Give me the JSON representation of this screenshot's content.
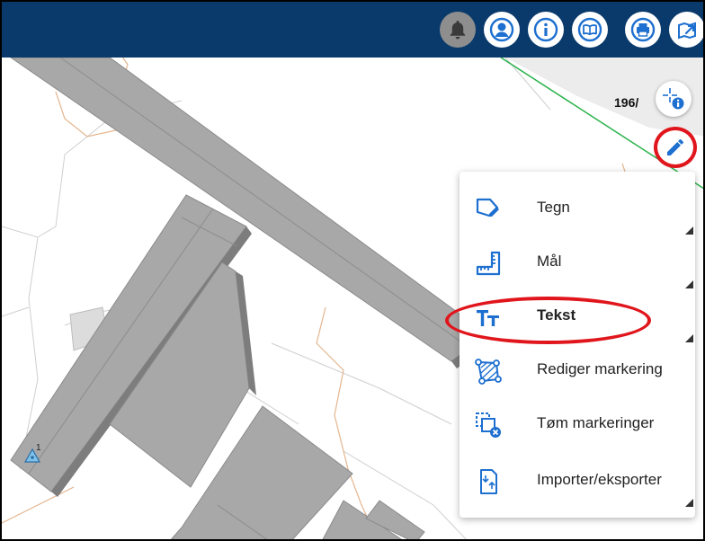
{
  "toolbar": {
    "buttons": [
      {
        "name": "notifications",
        "icon": "bell-icon",
        "active": true
      },
      {
        "name": "user",
        "icon": "user-icon"
      },
      {
        "name": "info",
        "icon": "info-icon"
      },
      {
        "name": "help",
        "icon": "book-icon"
      },
      {
        "name": "print",
        "icon": "printer-icon"
      },
      {
        "name": "share",
        "icon": "map-share-icon"
      }
    ]
  },
  "map": {
    "scale_text": "196/",
    "feature_label": "1"
  },
  "draw_menu": {
    "items": [
      {
        "name": "draw",
        "label": "Tegn",
        "icon": "draw-shape-icon"
      },
      {
        "name": "measure",
        "label": "Mål",
        "icon": "ruler-icon"
      },
      {
        "name": "text",
        "label": "Tekst",
        "icon": "text-tool-icon",
        "highlighted": true
      },
      {
        "name": "edit-selection",
        "label": "Rediger markering",
        "icon": "edit-polygon-icon"
      },
      {
        "name": "clear-selections",
        "label": "Tøm markeringer",
        "icon": "clear-selection-icon"
      },
      {
        "name": "import-export",
        "label": "Importer/eksporter",
        "icon": "import-export-icon"
      }
    ]
  },
  "colors": {
    "header": "#0a3a6b",
    "accent": "#1d6fd0",
    "highlight": "#e0161c",
    "building": "#a8a8a8"
  }
}
